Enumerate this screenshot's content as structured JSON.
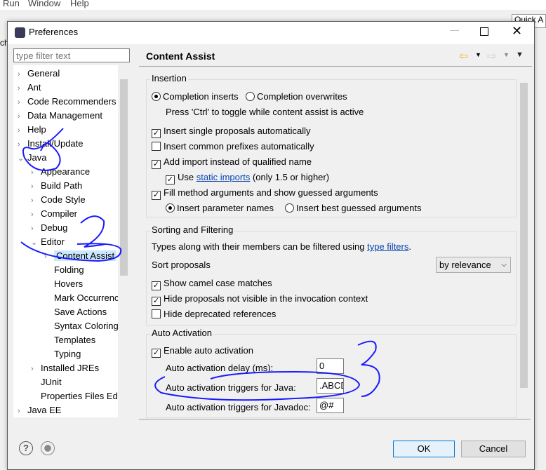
{
  "menubar": [
    "Run",
    "Window",
    "Help"
  ],
  "bg": {
    "quick_access": "Quick A",
    "tab_fragment": "ch"
  },
  "dialog": {
    "title": "Preferences",
    "minimize_icon": "minimize-icon",
    "maximize_icon": "maximize-icon",
    "close_icon": "close-icon"
  },
  "filter": {
    "placeholder": "type filter text"
  },
  "tree": [
    {
      "label": "General",
      "level": 0,
      "state": "collapsed"
    },
    {
      "label": "Ant",
      "level": 0,
      "state": "collapsed"
    },
    {
      "label": "Code Recommenders",
      "level": 0,
      "state": "collapsed"
    },
    {
      "label": "Data Management",
      "level": 0,
      "state": "collapsed"
    },
    {
      "label": "Help",
      "level": 0,
      "state": "collapsed"
    },
    {
      "label": "Install/Update",
      "level": 0,
      "state": "collapsed"
    },
    {
      "label": "Java",
      "level": 0,
      "state": "expanded"
    },
    {
      "label": "Appearance",
      "level": 1,
      "state": "collapsed"
    },
    {
      "label": "Build Path",
      "level": 1,
      "state": "collapsed"
    },
    {
      "label": "Code Style",
      "level": 1,
      "state": "collapsed"
    },
    {
      "label": "Compiler",
      "level": 1,
      "state": "collapsed"
    },
    {
      "label": "Debug",
      "level": 1,
      "state": "collapsed"
    },
    {
      "label": "Editor",
      "level": 1,
      "state": "expanded"
    },
    {
      "label": "Content Assist",
      "level": 2,
      "state": "collapsed",
      "selected": true
    },
    {
      "label": "Folding",
      "level": 2,
      "state": "leaf"
    },
    {
      "label": "Hovers",
      "level": 2,
      "state": "leaf"
    },
    {
      "label": "Mark Occurrences",
      "level": 2,
      "state": "leaf"
    },
    {
      "label": "Save Actions",
      "level": 2,
      "state": "leaf"
    },
    {
      "label": "Syntax Coloring",
      "level": 2,
      "state": "leaf"
    },
    {
      "label": "Templates",
      "level": 2,
      "state": "leaf"
    },
    {
      "label": "Typing",
      "level": 2,
      "state": "leaf"
    },
    {
      "label": "Installed JREs",
      "level": 1,
      "state": "collapsed"
    },
    {
      "label": "JUnit",
      "level": 1,
      "state": "leaf"
    },
    {
      "label": "Properties Files Editor",
      "level": 1,
      "state": "leaf"
    },
    {
      "label": "Java EE",
      "level": 0,
      "state": "collapsed"
    }
  ],
  "page": {
    "title": "Content Assist"
  },
  "insertion": {
    "title": "Insertion",
    "completion_inserts": "Completion inserts",
    "completion_overwrites": "Completion overwrites",
    "toggle_hint": "Press 'Ctrl' to toggle while content assist is active",
    "insert_single": "Insert single proposals automatically",
    "insert_common": "Insert common prefixes automatically",
    "add_import": "Add import instead of qualified name",
    "use": "Use",
    "static_imports": "static imports",
    "only15": "(only 1.5 or higher)",
    "fill_args": "Fill method arguments and show guessed arguments",
    "insert_param_names": "Insert parameter names",
    "insert_best_guessed": "Insert best guessed arguments"
  },
  "sorting": {
    "title": "Sorting and Filtering",
    "types_text": "Types along with their members can be filtered using",
    "type_filters": "type filters",
    "period": ".",
    "sort_label": "Sort proposals",
    "sort_value": "by relevance",
    "camel": "Show camel case matches",
    "hide_not_visible": "Hide proposals not visible in the invocation context",
    "hide_deprecated": "Hide deprecated references"
  },
  "auto": {
    "title": "Auto Activation",
    "enable": "Enable auto activation",
    "delay_label": "Auto activation delay (ms):",
    "delay_value": "0",
    "java_label": "Auto activation triggers for Java:",
    "java_value": ".ABCDEFGHIJKLMNOPQRSTUVWXYZabcdefghijklmnopqrstuvwxyz",
    "javadoc_label": "Auto activation triggers for Javadoc:",
    "javadoc_value": "@#"
  },
  "buttons": {
    "ok": "OK",
    "cancel": "Cancel"
  },
  "annotations": [
    "1",
    "2",
    "3"
  ],
  "colors": {
    "annotation": "#1a1aff",
    "selection": "#cce8ff",
    "link": "#0645ad"
  }
}
